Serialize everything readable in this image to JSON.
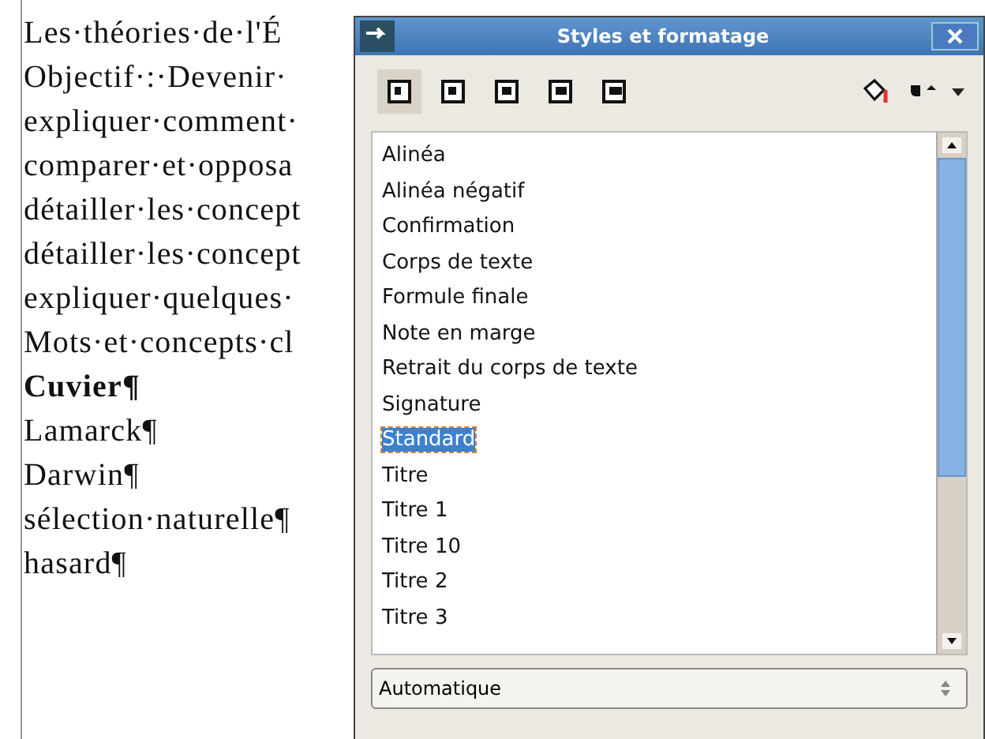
{
  "document": {
    "lines": [
      {
        "text": "Les·théories·de·l'É",
        "bold": false
      },
      {
        "text": "Objectif·:·Devenir·",
        "bold": false
      },
      {
        "text": "expliquer·comment·",
        "bold": false
      },
      {
        "text": "comparer·et·opposa",
        "bold": false
      },
      {
        "text": "détailler·les·concept",
        "bold": false
      },
      {
        "text": "détailler·les·concept",
        "bold": false
      },
      {
        "text": "expliquer·quelques·",
        "bold": false
      },
      {
        "text": "Mots·et·concepts·cl",
        "bold": false
      },
      {
        "text": "Cuvier¶",
        "bold": true
      },
      {
        "text": "Lamarck¶",
        "bold": false
      },
      {
        "text": "Darwin¶",
        "bold": false
      },
      {
        "text": "sélection·naturelle¶",
        "bold": false
      },
      {
        "text": "hasard¶",
        "bold": false
      }
    ]
  },
  "dialog": {
    "title": "Styles et formatage",
    "style_families": [
      {
        "selected": true
      },
      {
        "selected": false
      },
      {
        "selected": false
      },
      {
        "selected": false
      },
      {
        "selected": false
      }
    ],
    "styles": [
      {
        "label": "Alinéa",
        "selected": false
      },
      {
        "label": "Alinéa négatif",
        "selected": false
      },
      {
        "label": "Confirmation",
        "selected": false
      },
      {
        "label": "Corps de texte",
        "selected": false
      },
      {
        "label": "Formule finale",
        "selected": false
      },
      {
        "label": "Note en marge",
        "selected": false
      },
      {
        "label": "Retrait du corps de texte",
        "selected": false
      },
      {
        "label": "Signature",
        "selected": false
      },
      {
        "label": "Standard",
        "selected": true
      },
      {
        "label": "Titre",
        "selected": false
      },
      {
        "label": "Titre 1",
        "selected": false
      },
      {
        "label": "Titre 10",
        "selected": false
      },
      {
        "label": "Titre 2",
        "selected": false
      },
      {
        "label": "Titre 3",
        "selected": false
      }
    ],
    "filter": "Automatique"
  }
}
